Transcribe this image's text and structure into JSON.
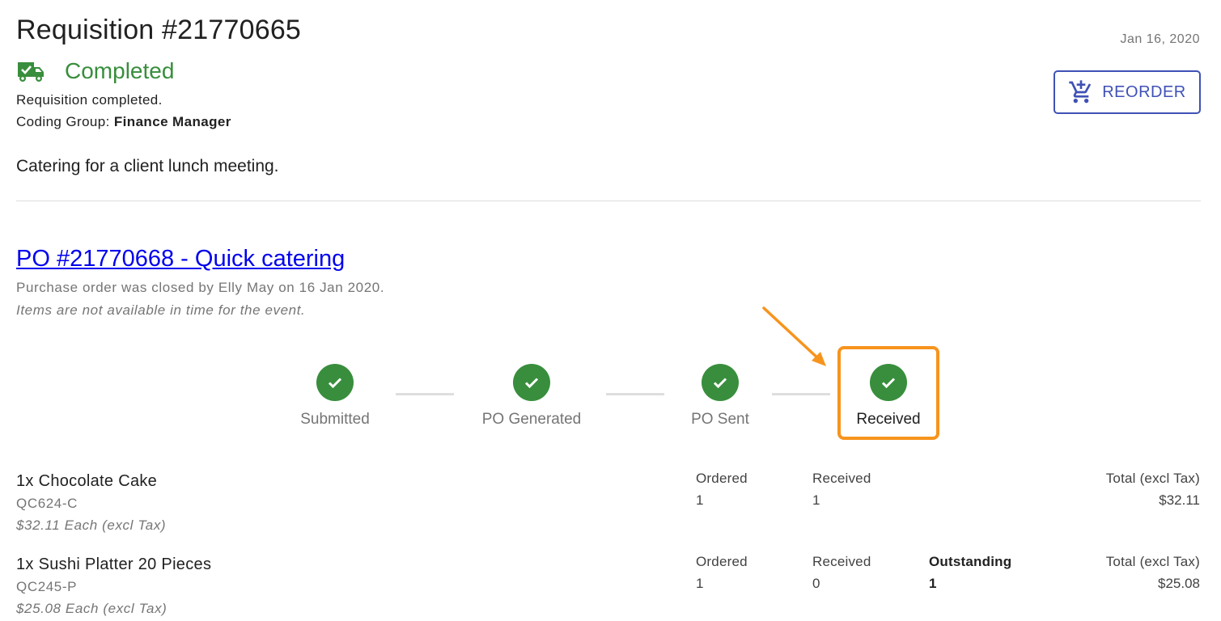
{
  "header": {
    "title": "Requisition #21770665",
    "date": "Jan 16, 2020",
    "status": "Completed",
    "status_icon": "truck-check-icon",
    "status_message": "Requisition completed.",
    "coding_group_label": "Coding Group: ",
    "coding_group_value": "Finance Manager",
    "reorder_label": "REORDER",
    "reorder_icon": "cart-plus-icon",
    "description": "Catering for a client lunch meeting."
  },
  "colors": {
    "success": "#388e3c",
    "primary": "#3f51b5",
    "link": "#0000ee",
    "highlight": "#f7941d",
    "muted": "#757575"
  },
  "po": {
    "link_text": "PO #21770668 - Quick catering",
    "closed_text": "Purchase order was closed by Elly May on 16 Jan 2020.",
    "reason_text": "Items are not available in time for the event."
  },
  "steps": [
    {
      "label": "Submitted",
      "complete": true,
      "active": false
    },
    {
      "label": "PO Generated",
      "complete": true,
      "active": false
    },
    {
      "label": "PO Sent",
      "complete": true,
      "active": false
    },
    {
      "label": "Received",
      "complete": true,
      "active": true
    }
  ],
  "items": [
    {
      "name": "1x Chocolate Cake",
      "sku": "QC624-C",
      "unit_price": "$32.11 Each (excl Tax)",
      "ordered_label": "Ordered",
      "ordered": "1",
      "received_label": "Received",
      "received": "1",
      "total_label": "Total (excl Tax)",
      "total": "$32.11"
    },
    {
      "name": "1x Sushi Platter 20 Pieces",
      "sku": "QC245-P",
      "unit_price": "$25.08 Each (excl Tax)",
      "ordered_label": "Ordered",
      "ordered": "1",
      "received_label": "Received",
      "received": "0",
      "outstanding_label": "Outstanding",
      "outstanding": "1",
      "total_label": "Total (excl Tax)",
      "total": "$25.08"
    }
  ]
}
